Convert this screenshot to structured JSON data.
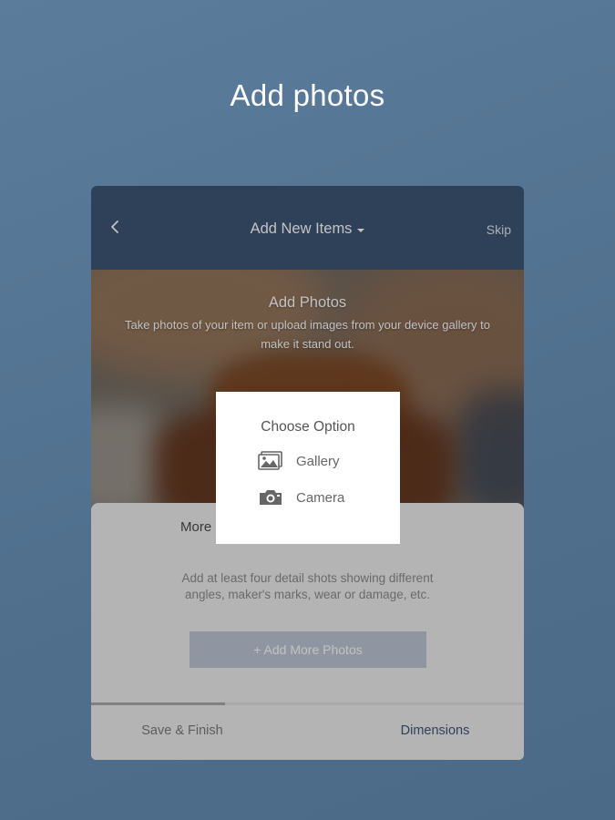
{
  "promo": {
    "title": "Add photos"
  },
  "app_header": {
    "back_icon": "chevron-left-icon",
    "title": "Add New Items",
    "title_caret_icon": "caret-down-icon",
    "skip_label": "Skip"
  },
  "hero": {
    "title": "Add Photos",
    "description": "Take photos of your item or upload images from your device gallery to make it stand out."
  },
  "sheet": {
    "more_label": "More",
    "instructions": "Add at least four detail shots showing different angles, maker's marks, wear or damage, etc.",
    "add_more_button": "+ Add More Photos",
    "progress_fraction": 0.31
  },
  "footer": {
    "save_finish": "Save & Finish",
    "dimensions": "Dimensions"
  },
  "dialog": {
    "title": "Choose Option",
    "options": [
      {
        "label": "Gallery",
        "icon": "gallery-icon"
      },
      {
        "label": "Camera",
        "icon": "camera-icon"
      }
    ]
  },
  "colors": {
    "header_bg": "#3f5676",
    "accent": "#3f5676",
    "button_bg": "#bcc6d4"
  }
}
